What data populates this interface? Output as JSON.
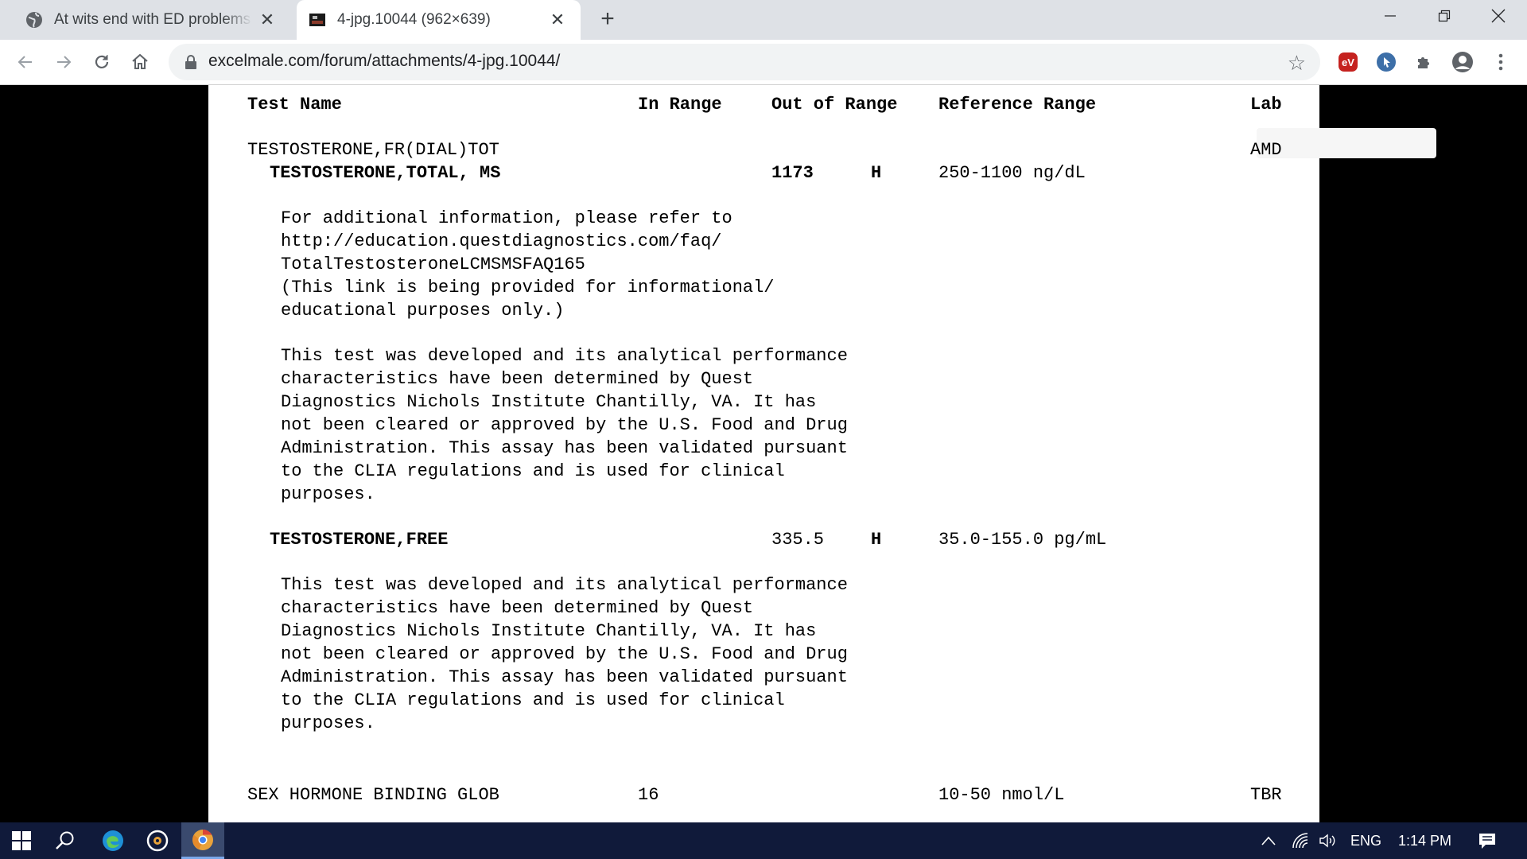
{
  "browser": {
    "tabs": [
      {
        "title": "At wits end with ED problems | ExcelMale",
        "icon": "globe-icon",
        "active": false
      },
      {
        "title": "4-jpg.10044 (962×639)",
        "icon": "image-thumbnail-icon",
        "active": true
      }
    ],
    "url": "excelmale.com/forum/attachments/4-jpg.10044/"
  },
  "report": {
    "headers": {
      "test_name": "Test Name",
      "in_range": "In Range",
      "out_of_range": "Out of Range",
      "reference_range": "Reference Range",
      "lab": "Lab"
    },
    "group": {
      "name": "TESTOSTERONE,FR(DIAL)TOT",
      "lab": "AMD"
    },
    "total": {
      "name": "TESTOSTERONE,TOTAL, MS",
      "value": "1173",
      "flag": "H",
      "range": "250-1100 ng/dL"
    },
    "note1": [
      "For additional information, please refer to",
      "http://education.questdiagnostics.com/faq/",
      "TotalTestosteroneLCMSMSFAQ165",
      "(This link is being provided for informational/",
      "educational purposes only.)"
    ],
    "note2": [
      "This test was developed and its analytical performance",
      "characteristics have been determined by Quest",
      "Diagnostics Nichols Institute Chantilly, VA. It has",
      "not been cleared or approved by the U.S. Food and Drug",
      "Administration. This assay has been validated pursuant",
      "to the CLIA regulations and is used for clinical",
      "purposes."
    ],
    "free": {
      "name": "TESTOSTERONE,FREE",
      "value": "335.5",
      "flag": "H",
      "range": "35.0-155.0 pg/mL"
    },
    "note3": [
      "This test was developed and its analytical performance",
      "characteristics have been determined by Quest",
      "Diagnostics Nichols Institute Chantilly, VA. It has",
      "not been cleared or approved by the U.S. Food and Drug",
      "Administration. This assay has been validated pursuant",
      "to the CLIA regulations and is used for clinical",
      "purposes."
    ],
    "shbg": {
      "name": "SEX HORMONE BINDING GLOB",
      "value": "16",
      "range": "10-50 nmol/L",
      "lab": "TBR"
    }
  },
  "taskbar": {
    "lang": "ENG",
    "time": "1:14 PM"
  },
  "colors": {
    "tab_strip": "#dee1e6",
    "taskbar": "#101a3a",
    "ext_red": "#c5221f",
    "ext_blue": "#3d6fa8"
  }
}
